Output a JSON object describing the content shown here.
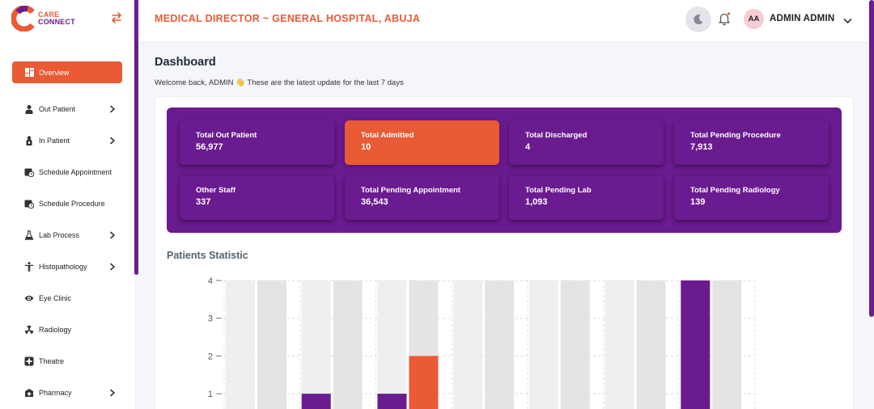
{
  "brand": {
    "line1": "CARE",
    "line2": "CONNECT",
    "colors": {
      "orange": "#ea5a35",
      "purple": "#6a1b8f"
    }
  },
  "header": {
    "title": "MEDICAL DIRECTOR ~ GENERAL HOSPITAL, ABUJA",
    "avatar_initials": "AA",
    "user_name": "ADMIN ADMIN"
  },
  "sidebar": {
    "items": [
      {
        "label": "Overview",
        "icon": "dashboard-icon",
        "chevron": false,
        "active": true
      },
      {
        "label": "Out Patient",
        "icon": "outpatient-icon",
        "chevron": true,
        "active": false
      },
      {
        "label": "In Patient",
        "icon": "inpatient-icon",
        "chevron": true,
        "active": false
      },
      {
        "label": "Schedule Appointment",
        "icon": "calendar-clock-icon",
        "chevron": false,
        "active": false
      },
      {
        "label": "Schedule Procedure",
        "icon": "calendar-clock-icon",
        "chevron": false,
        "active": false
      },
      {
        "label": "Lab Process",
        "icon": "flask-icon",
        "chevron": true,
        "active": false
      },
      {
        "label": "Histopathology",
        "icon": "body-icon",
        "chevron": true,
        "active": false
      },
      {
        "label": "Eye Clinic",
        "icon": "eye-icon",
        "chevron": false,
        "active": false
      },
      {
        "label": "Radiology",
        "icon": "radiation-icon",
        "chevron": false,
        "active": false
      },
      {
        "label": "Theatre",
        "icon": "medical-cross-icon",
        "chevron": false,
        "active": false
      },
      {
        "label": "Pharmacy",
        "icon": "pharmacy-icon",
        "chevron": true,
        "active": false
      }
    ]
  },
  "main": {
    "title": "Dashboard",
    "welcome": "Welcome back, ADMIN 👋 These are the latest update for the last 7 days",
    "stats": [
      {
        "label": "Total Out Patient",
        "value": "56,977",
        "active": false
      },
      {
        "label": "Total Admitted",
        "value": "10",
        "active": true
      },
      {
        "label": "Total Discharged",
        "value": "4",
        "active": false
      },
      {
        "label": "Total Pending Procedure",
        "value": "7,913",
        "active": false
      },
      {
        "label": "Other Staff",
        "value": "337",
        "active": false
      },
      {
        "label": "Total Pending Appointment",
        "value": "36,543",
        "active": false
      },
      {
        "label": "Total Pending Lab",
        "value": "1,093",
        "active": false
      },
      {
        "label": "Total Pending Radiology",
        "value": "139",
        "active": false
      }
    ],
    "chart_title": "Patients Statistic"
  },
  "chart_data": {
    "type": "bar",
    "title": "Patients Statistic",
    "ylim": [
      0,
      4
    ],
    "yticks": [
      "1",
      "2",
      "3",
      "4"
    ],
    "grid": true,
    "categories": [
      "",
      "",
      "",
      "",
      "",
      "",
      ""
    ],
    "series": [
      {
        "color": "#6a1b8f",
        "values": [
          0,
          1,
          1,
          0,
          0,
          0,
          4
        ]
      },
      {
        "color": "#ea5a35",
        "values": [
          0,
          0,
          2,
          0,
          0,
          0,
          0
        ]
      }
    ]
  }
}
